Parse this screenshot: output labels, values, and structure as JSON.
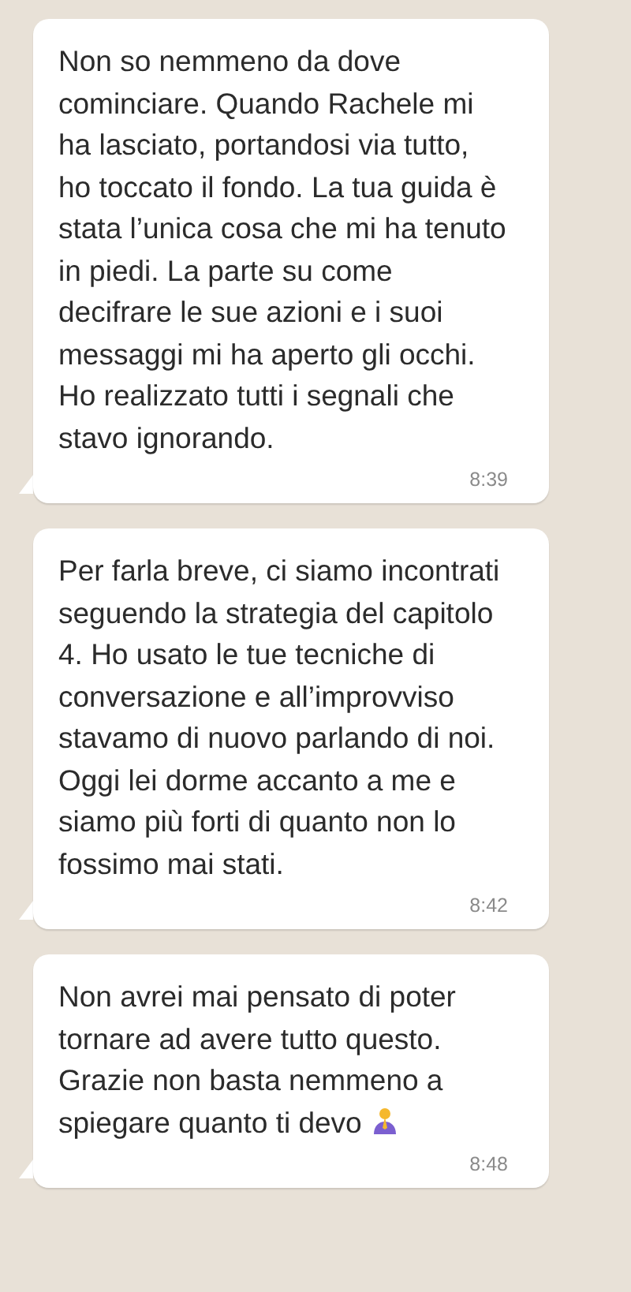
{
  "messages": [
    {
      "text": "Non so nemmeno da dove cominciare. Quando Rachele mi ha lasciato, portandosi via tutto, ho toccato il fondo. La tua guida è stata l’unica cosa che mi ha tenuto in piedi. La parte su come decifrare le sue azioni e i suoi messaggi mi ha aperto gli occhi. Ho realizzato tutti i segnali che stavo ignorando.",
      "time": "8:39"
    },
    {
      "text": "Per farla breve, ci siamo incontrati seguendo la strategia del capitolo 4. Ho usato le tue tecniche di conversazione e all’improvviso stavamo di nuovo parlando di noi. Oggi lei dorme accanto a me e siamo più forti di quanto non lo fossimo mai stati.",
      "time": "8:42"
    },
    {
      "text": "Non avrei mai pensato di poter tornare ad avere tutto questo. Grazie non basta nemmeno a spiegare quanto ti devo",
      "time": "8:48",
      "trailing_icon": true
    }
  ]
}
